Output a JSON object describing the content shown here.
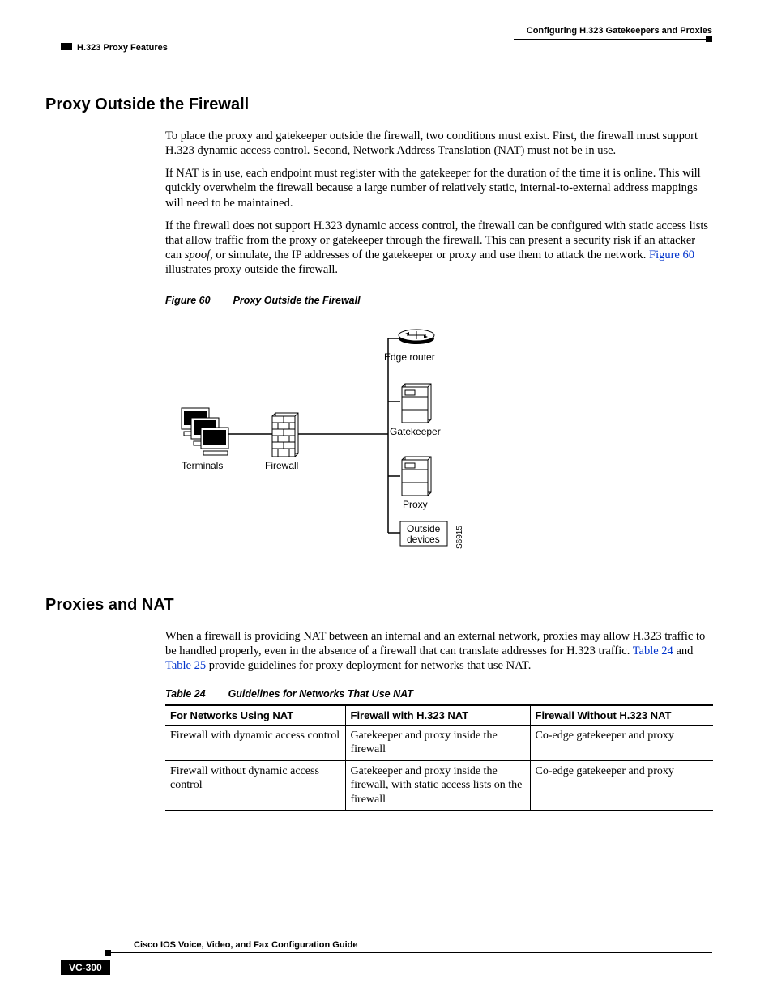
{
  "header": {
    "left": "H.323 Proxy Features",
    "right": "Configuring H.323 Gatekeepers and Proxies"
  },
  "section1": {
    "heading": "Proxy Outside the Firewall",
    "p1": "To place the proxy and gatekeeper outside the firewall, two conditions must exist. First, the firewall must support H.323 dynamic access control. Second, Network Address Translation (NAT) must not be in use.",
    "p2": "If NAT is in use, each endpoint must register with the gatekeeper for the duration of the time it is online. This will quickly overwhelm the firewall because a large number of relatively static, internal-to-external address mappings will need to be maintained.",
    "p3a": "If the firewall does not support H.323 dynamic access control, the firewall can be configured with static access lists that allow traffic from the proxy or gatekeeper through the firewall. This can present a security risk if an attacker can ",
    "p3_italic": "spoof",
    "p3b": ", or simulate, the IP addresses of the gatekeeper or proxy and use them to attack the network. ",
    "p3_link": "Figure 60",
    "p3c": " illustrates proxy outside the firewall."
  },
  "figure": {
    "label": "Figure 60",
    "title": "Proxy Outside the Firewall",
    "labels": {
      "edge_router": "Edge router",
      "gatekeeper": "Gatekeeper",
      "terminals": "Terminals",
      "firewall": "Firewall",
      "proxy": "Proxy",
      "outside_devices1": "Outside",
      "outside_devices2": "devices"
    },
    "side_num": "S6915"
  },
  "section2": {
    "heading": "Proxies and NAT",
    "p1a": "When a firewall is providing NAT between an internal and an external network, proxies may allow H.323 traffic to be handled properly, even in the absence of a firewall that can translate addresses for H.323 traffic. ",
    "p1_link1": "Table 24",
    "p1b": " and ",
    "p1_link2": "Table 25",
    "p1c": " provide guidelines for proxy deployment for networks that use NAT."
  },
  "table": {
    "label": "Table 24",
    "title": "Guidelines for Networks That Use NAT",
    "headers": {
      "c1": "For Networks Using NAT",
      "c2": "Firewall with H.323 NAT",
      "c3": "Firewall Without H.323 NAT"
    },
    "rows": [
      {
        "c1": "Firewall with dynamic access control",
        "c2": "Gatekeeper and proxy inside the firewall",
        "c3": "Co-edge gatekeeper and proxy"
      },
      {
        "c1": "Firewall without dynamic access control",
        "c2": "Gatekeeper and proxy inside the firewall, with static access lists on the firewall",
        "c3": "Co-edge gatekeeper and proxy"
      }
    ]
  },
  "footer": {
    "title": "Cisco IOS Voice, Video, and Fax Configuration Guide",
    "page": "VC-300"
  }
}
